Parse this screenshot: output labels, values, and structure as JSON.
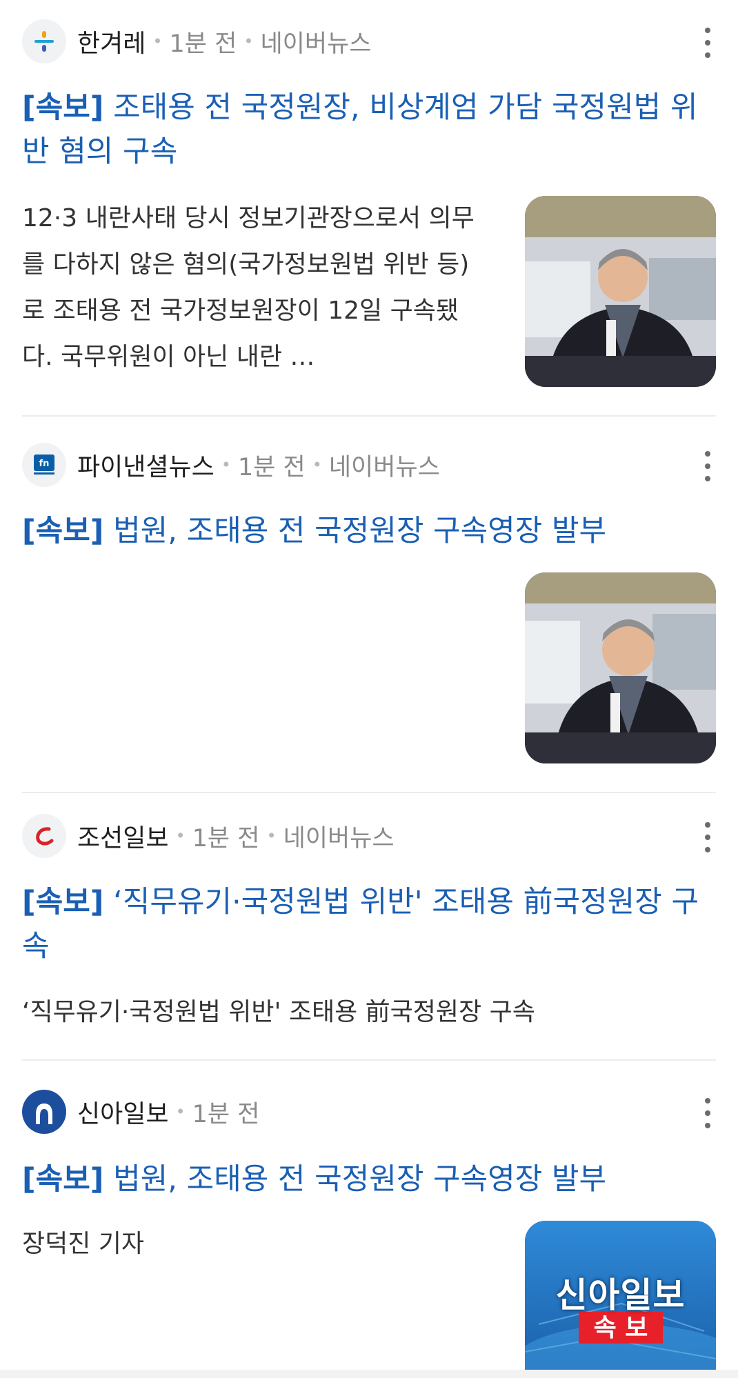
{
  "articles": [
    {
      "source": "한겨레",
      "time": "1분 전",
      "platform": "네이버뉴스",
      "tag": "[속보]",
      "headline": "조태용 전 국정원장, 비상계엄 가담 국정원법 위반 혐의 구속",
      "snippet": "12·3 내란사태 당시 정보기관장으로서 의무를 다하지 않은 혐의(국가정보원법 위반 등)로 조태용 전 국가정보원장이 12일 구속됐다. 국무위원이 아닌 내란 …",
      "logo_icon": "hankyoreh-logo-icon",
      "thumb_icon": "person-photo-icon"
    },
    {
      "source": "파이낸셜뉴스",
      "time": "1분 전",
      "platform": "네이버뉴스",
      "tag": "[속보]",
      "headline": "법원, 조태용 전 국정원장 구속영장 발부",
      "snippet": "",
      "logo_icon": "fn-logo-icon",
      "thumb_icon": "person-photo-icon"
    },
    {
      "source": "조선일보",
      "time": "1분 전",
      "platform": "네이버뉴스",
      "tag": "[속보]",
      "headline": "‘직무유기·국정원법 위반' 조태용 前국정원장 구속",
      "snippet": "‘직무유기·국정원법 위반' 조태용 前국정원장 구속",
      "logo_icon": "chosun-logo-icon"
    },
    {
      "source": "신아일보",
      "time": "1분 전",
      "tag": "[속보]",
      "headline": "법원, 조태용 전 국정원장 구속영장 발부",
      "snippet": "장덕진 기자",
      "logo_icon": "shinailbo-logo-icon",
      "thumb_icon": "shinailbo-breaking-thumbnail",
      "thumb_title": "신아일보",
      "thumb_badge": "속 보"
    }
  ],
  "icons": {
    "more": "more-vertical-icon",
    "separator": "middle-dot"
  },
  "colors": {
    "headline": "#1a5fb4",
    "meta": "#8a8a8a",
    "text": "#333333",
    "separator": "#ececec",
    "breaking_badge": "#e8202a",
    "thumb_blue": "#1f72c4"
  }
}
